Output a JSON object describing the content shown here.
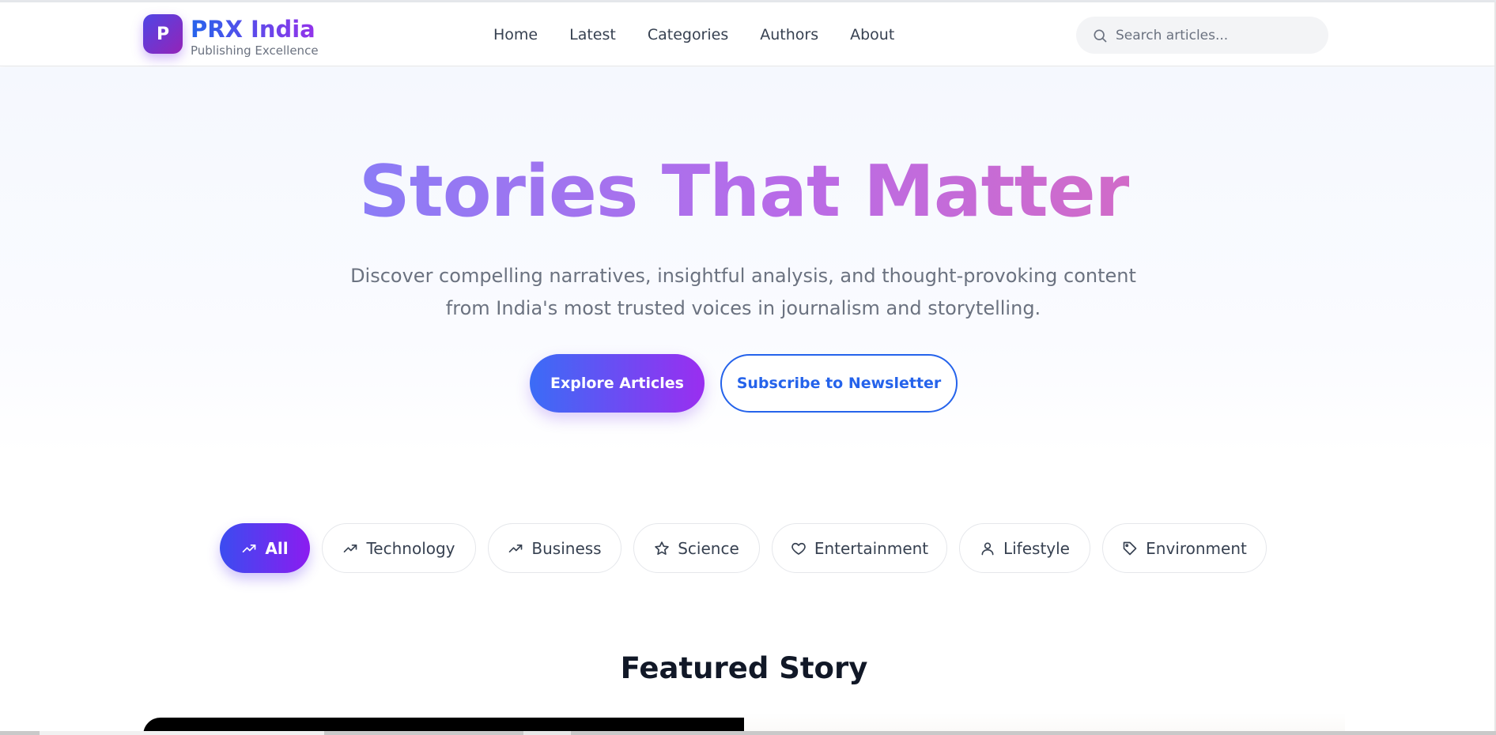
{
  "brand": {
    "logo_letter": "P",
    "name": "PRX India",
    "tagline": "Publishing Excellence"
  },
  "nav": {
    "items": [
      {
        "label": "Home"
      },
      {
        "label": "Latest"
      },
      {
        "label": "Categories"
      },
      {
        "label": "Authors"
      },
      {
        "label": "About"
      }
    ]
  },
  "search": {
    "placeholder": "Search articles...",
    "value": ""
  },
  "hero": {
    "title": "Stories That Matter",
    "subtitle": "Discover compelling narratives, insightful analysis, and thought-provoking content from India's most trusted voices in journalism and storytelling.",
    "primary_button": "Explore Articles",
    "secondary_button": "Subscribe to Newsletter"
  },
  "categories": [
    {
      "label": "All",
      "icon": "trending-up-icon",
      "active": true
    },
    {
      "label": "Technology",
      "icon": "trending-up-icon",
      "active": false
    },
    {
      "label": "Business",
      "icon": "trending-up-icon",
      "active": false
    },
    {
      "label": "Science",
      "icon": "star-icon",
      "active": false
    },
    {
      "label": "Entertainment",
      "icon": "heart-icon",
      "active": false
    },
    {
      "label": "Lifestyle",
      "icon": "user-icon",
      "active": false
    },
    {
      "label": "Environment",
      "icon": "tag-icon",
      "active": false
    }
  ],
  "featured": {
    "heading": "Featured Story"
  },
  "colors": {
    "brand_blue": "#2563eb",
    "brand_purple": "#9333ea",
    "hero_title_start": "#8b7cf6",
    "hero_title_end": "#d16bc8"
  }
}
